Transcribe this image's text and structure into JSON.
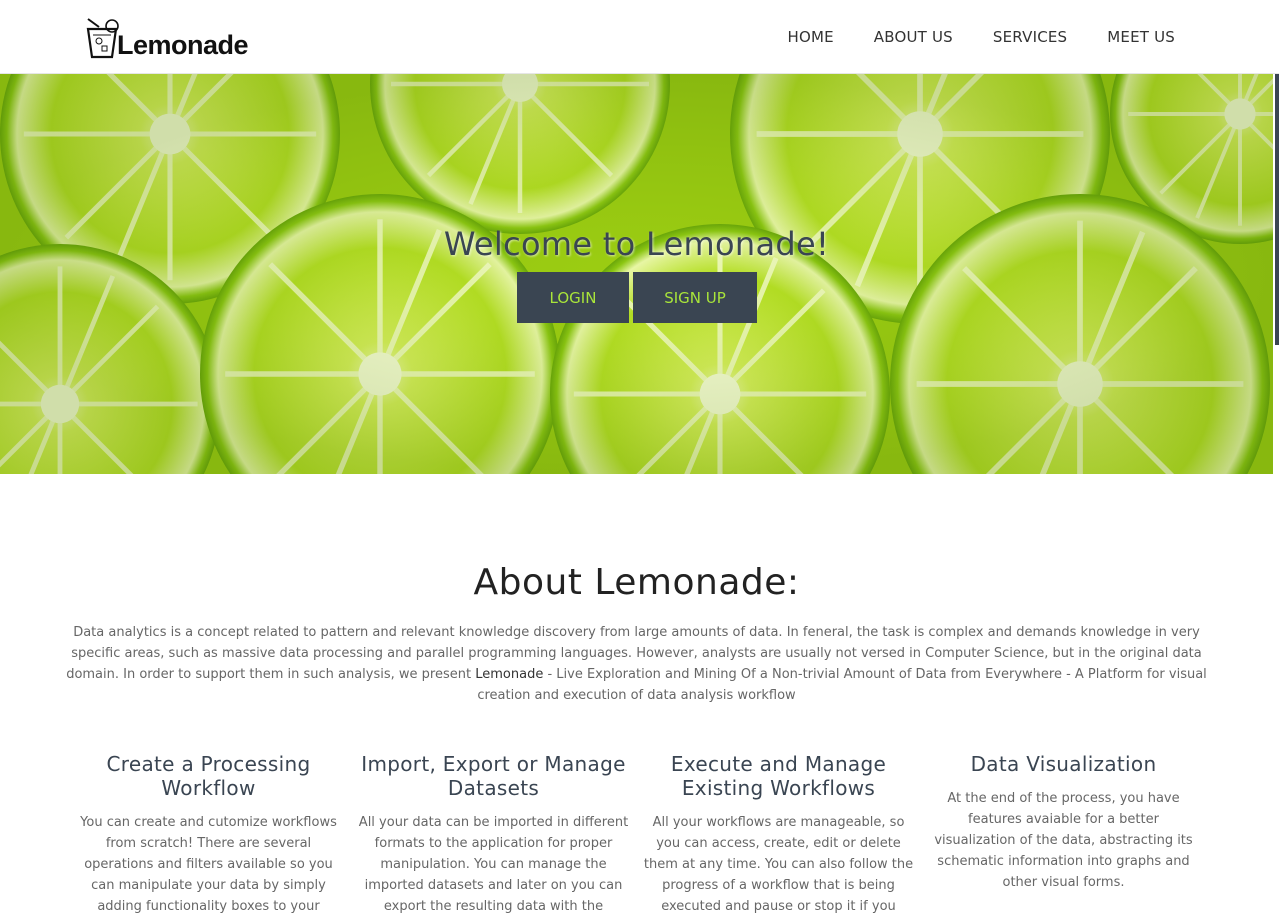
{
  "header": {
    "logo_text": "Lemonade",
    "nav": [
      {
        "label": "HOME"
      },
      {
        "label": "ABOUT US"
      },
      {
        "label": "SERVICES"
      },
      {
        "label": "MEET US"
      }
    ]
  },
  "hero": {
    "title": "Welcome to Lemonade!",
    "login_label": "LOGIN",
    "signup_label": "SIGN UP"
  },
  "about": {
    "title": "About Lemonade:",
    "text_before": "Data analytics is a concept related to pattern and relevant knowledge discovery from large amounts of data. In feneral, the task is complex and demands knowledge in very specific areas, such as massive data processing and parallel programming languages. However, analysts are usually not versed in Computer Science, but in the original data domain. In order to support them in such analysis, we present ",
    "brand": "Lemonade",
    "text_after": " - Live Exploration and Mining Of a Non-trivial Amount of Data from Everywhere - A Platform for visual creation and execution of data analysis workflow"
  },
  "features": [
    {
      "title": "Create a Processing Workflow",
      "text": "You can create and cutomize workflows from scratch! There are several operations and filters available so you can manipulate your data by simply adding functionality boxes to your"
    },
    {
      "title": "Import, Export or Manage Datasets",
      "text": "All your data can be imported in different formats to the application for proper manipulation. You can manage the imported datasets and later on you can export the resulting data with the"
    },
    {
      "title": "Execute and Manage Existing Workflows",
      "text": "All your workflows are manageable, so you can access, create, edit or delete them at any time. You can also follow the progress of a workflow that is being executed and pause or stop it if you"
    },
    {
      "title": "Data Visualization",
      "text": "At the end of the process, you have features avaiable for a better visualization of the data, abstracting its schematic information into graphs and other visual forms."
    }
  ],
  "colors": {
    "accent_dark": "#3a4552",
    "button_text": "#a9e53a",
    "lime": "#a6d60f"
  }
}
